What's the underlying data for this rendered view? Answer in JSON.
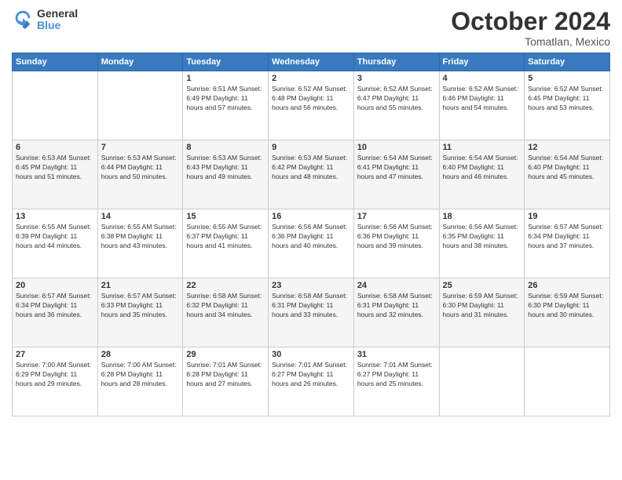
{
  "logo": {
    "general": "General",
    "blue": "Blue"
  },
  "title": "October 2024",
  "location": "Tomatlan, Mexico",
  "weekdays": [
    "Sunday",
    "Monday",
    "Tuesday",
    "Wednesday",
    "Thursday",
    "Friday",
    "Saturday"
  ],
  "weeks": [
    [
      {
        "day": "",
        "info": ""
      },
      {
        "day": "",
        "info": ""
      },
      {
        "day": "1",
        "info": "Sunrise: 6:51 AM\nSunset: 6:49 PM\nDaylight: 11 hours and 57 minutes."
      },
      {
        "day": "2",
        "info": "Sunrise: 6:52 AM\nSunset: 6:48 PM\nDaylight: 11 hours and 56 minutes."
      },
      {
        "day": "3",
        "info": "Sunrise: 6:52 AM\nSunset: 6:47 PM\nDaylight: 11 hours and 55 minutes."
      },
      {
        "day": "4",
        "info": "Sunrise: 6:52 AM\nSunset: 6:46 PM\nDaylight: 11 hours and 54 minutes."
      },
      {
        "day": "5",
        "info": "Sunrise: 6:52 AM\nSunset: 6:45 PM\nDaylight: 11 hours and 53 minutes."
      }
    ],
    [
      {
        "day": "6",
        "info": "Sunrise: 6:53 AM\nSunset: 6:45 PM\nDaylight: 11 hours and 51 minutes."
      },
      {
        "day": "7",
        "info": "Sunrise: 6:53 AM\nSunset: 6:44 PM\nDaylight: 11 hours and 50 minutes."
      },
      {
        "day": "8",
        "info": "Sunrise: 6:53 AM\nSunset: 6:43 PM\nDaylight: 11 hours and 49 minutes."
      },
      {
        "day": "9",
        "info": "Sunrise: 6:53 AM\nSunset: 6:42 PM\nDaylight: 11 hours and 48 minutes."
      },
      {
        "day": "10",
        "info": "Sunrise: 6:54 AM\nSunset: 6:41 PM\nDaylight: 11 hours and 47 minutes."
      },
      {
        "day": "11",
        "info": "Sunrise: 6:54 AM\nSunset: 6:40 PM\nDaylight: 11 hours and 46 minutes."
      },
      {
        "day": "12",
        "info": "Sunrise: 6:54 AM\nSunset: 6:40 PM\nDaylight: 11 hours and 45 minutes."
      }
    ],
    [
      {
        "day": "13",
        "info": "Sunrise: 6:55 AM\nSunset: 6:39 PM\nDaylight: 11 hours and 44 minutes."
      },
      {
        "day": "14",
        "info": "Sunrise: 6:55 AM\nSunset: 6:38 PM\nDaylight: 11 hours and 43 minutes."
      },
      {
        "day": "15",
        "info": "Sunrise: 6:55 AM\nSunset: 6:37 PM\nDaylight: 11 hours and 41 minutes."
      },
      {
        "day": "16",
        "info": "Sunrise: 6:56 AM\nSunset: 6:36 PM\nDaylight: 11 hours and 40 minutes."
      },
      {
        "day": "17",
        "info": "Sunrise: 6:56 AM\nSunset: 6:36 PM\nDaylight: 11 hours and 39 minutes."
      },
      {
        "day": "18",
        "info": "Sunrise: 6:56 AM\nSunset: 6:35 PM\nDaylight: 11 hours and 38 minutes."
      },
      {
        "day": "19",
        "info": "Sunrise: 6:57 AM\nSunset: 6:34 PM\nDaylight: 11 hours and 37 minutes."
      }
    ],
    [
      {
        "day": "20",
        "info": "Sunrise: 6:57 AM\nSunset: 6:34 PM\nDaylight: 11 hours and 36 minutes."
      },
      {
        "day": "21",
        "info": "Sunrise: 6:57 AM\nSunset: 6:33 PM\nDaylight: 11 hours and 35 minutes."
      },
      {
        "day": "22",
        "info": "Sunrise: 6:58 AM\nSunset: 6:32 PM\nDaylight: 11 hours and 34 minutes."
      },
      {
        "day": "23",
        "info": "Sunrise: 6:58 AM\nSunset: 6:31 PM\nDaylight: 11 hours and 33 minutes."
      },
      {
        "day": "24",
        "info": "Sunrise: 6:58 AM\nSunset: 6:31 PM\nDaylight: 11 hours and 32 minutes."
      },
      {
        "day": "25",
        "info": "Sunrise: 6:59 AM\nSunset: 6:30 PM\nDaylight: 11 hours and 31 minutes."
      },
      {
        "day": "26",
        "info": "Sunrise: 6:59 AM\nSunset: 6:30 PM\nDaylight: 11 hours and 30 minutes."
      }
    ],
    [
      {
        "day": "27",
        "info": "Sunrise: 7:00 AM\nSunset: 6:29 PM\nDaylight: 11 hours and 29 minutes."
      },
      {
        "day": "28",
        "info": "Sunrise: 7:00 AM\nSunset: 6:28 PM\nDaylight: 11 hours and 28 minutes."
      },
      {
        "day": "29",
        "info": "Sunrise: 7:01 AM\nSunset: 6:28 PM\nDaylight: 11 hours and 27 minutes."
      },
      {
        "day": "30",
        "info": "Sunrise: 7:01 AM\nSunset: 6:27 PM\nDaylight: 11 hours and 26 minutes."
      },
      {
        "day": "31",
        "info": "Sunrise: 7:01 AM\nSunset: 6:27 PM\nDaylight: 11 hours and 25 minutes."
      },
      {
        "day": "",
        "info": ""
      },
      {
        "day": "",
        "info": ""
      }
    ]
  ]
}
